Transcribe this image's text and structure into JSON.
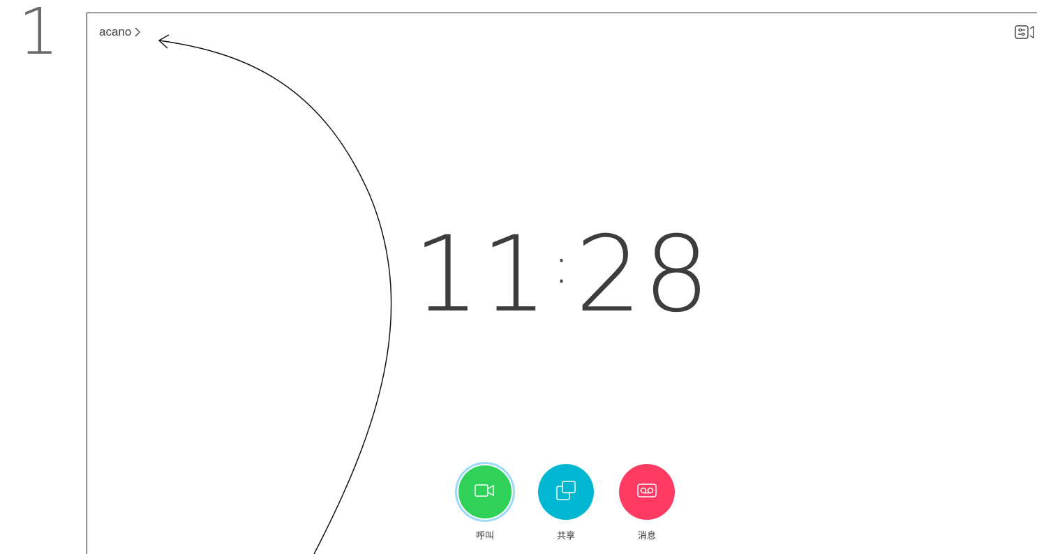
{
  "step": {
    "number": "1"
  },
  "header": {
    "breadcrumb": "acano"
  },
  "clock": {
    "hours": "11",
    "separator": ":",
    "minutes": "28"
  },
  "actions": [
    {
      "label": "呼叫",
      "icon": "video-camera-icon",
      "color": "#2fd158"
    },
    {
      "label": "共享",
      "icon": "share-screen-icon",
      "color": "#00b7d1"
    },
    {
      "label": "消息",
      "icon": "voicemail-icon",
      "color": "#ff3b64"
    }
  ],
  "icons": {
    "top_right": "settings-camera-icon",
    "breadcrumb_chevron": "chevron-right-icon"
  }
}
